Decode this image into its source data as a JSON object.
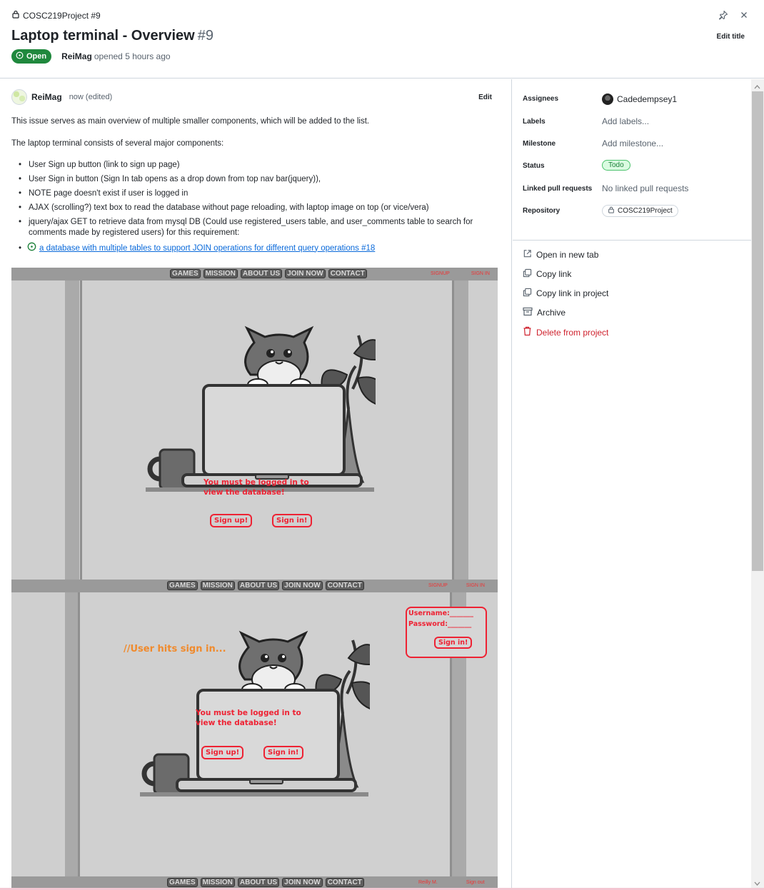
{
  "header": {
    "breadcrumb": "COSC219Project #9",
    "title": "Laptop terminal - Overview",
    "number": "#9",
    "state_label": "Open",
    "opened_by": "ReiMag",
    "opened_text": "opened 5 hours ago",
    "edit_title_label": "Edit title"
  },
  "comment": {
    "author": "ReiMag",
    "meta": "now (edited)",
    "edit_label": "Edit",
    "para1": "This issue serves as main overview of multiple smaller components, which will be added to the list.",
    "para2": "The laptop terminal consists of several major components:",
    "items": [
      "User Sign up button (link to sign up page)",
      "User Sign in button (Sign In tab opens as a drop down from top nav bar(jquery)),",
      "NOTE page doesn't exist if user is logged in",
      "AJAX (scrolling?) text box to read the database without page reloading, with laptop image on top (or vice/vera)",
      "jquery/ajax GET to retrieve data from mysql DB (Could use registered_users table, and user_comments table to search for comments made by registered users) for this requirement:"
    ],
    "linked_issue": "a database with multiple tables to support JOIN operations for different query operations #18"
  },
  "mockup": {
    "nav_buttons": [
      "GAMES",
      "MISSION",
      "ABOUT US",
      "JOIN NOW",
      "CONTACT"
    ],
    "signup_link": "SIGNUP",
    "signin_link": "SIGN IN",
    "laptop_msg_line1": "You must be logged in to",
    "laptop_msg_line2": "view the database!",
    "signup_btn": "Sign up!",
    "signin_btn": "Sign in!",
    "note": "//User hits sign in...",
    "popup_username": "Username:_______",
    "popup_password": "Password:_______",
    "popup_btn": "Sign in!",
    "user_link": "Reilly M.",
    "signout_link": "Sign out"
  },
  "sidebar": {
    "assignees_label": "Assignees",
    "assignee": "Cadedempsey1",
    "labels_label": "Labels",
    "labels_value": "Add labels...",
    "milestone_label": "Milestone",
    "milestone_value": "Add milestone...",
    "status_label": "Status",
    "status_value": "Todo",
    "linked_pr_label": "Linked pull requests",
    "linked_pr_value": "No linked pull requests",
    "repository_label": "Repository",
    "repository_value": "COSC219Project",
    "actions": {
      "open_new_tab": "Open in new tab",
      "copy_link": "Copy link",
      "copy_link_project": "Copy link in project",
      "archive": "Archive",
      "delete": "Delete from project"
    }
  },
  "colors": {
    "open_green": "#1f883d",
    "link_blue": "#0969da",
    "danger_red": "#cf222e",
    "mockup_red": "#ee2233",
    "mockup_orange": "#f08a2c"
  }
}
